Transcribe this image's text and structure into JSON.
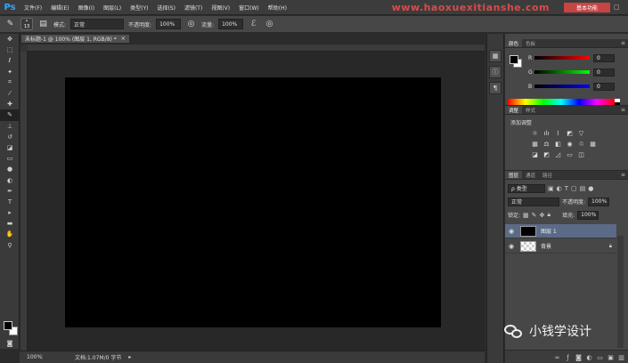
{
  "app": {
    "logo": "Ps",
    "menus": [
      "文件(F)",
      "编辑(E)",
      "图像(I)",
      "图层(L)",
      "类型(Y)",
      "选择(S)",
      "滤镜(T)",
      "视图(V)",
      "窗口(W)",
      "帮助(H)"
    ],
    "watermark": "www.haoxuexitianshe.com",
    "workspace_label": "基本功能",
    "window_controls": "▢"
  },
  "options": {
    "brush_size": "13",
    "mode_label": "模式:",
    "mode_value": "正常",
    "opacity_label": "不透明度:",
    "opacity_value": "100%",
    "flow_label": "流量:",
    "flow_value": "100%"
  },
  "document": {
    "tab_label": "未标题-1 @ 100% (图层 1, RGB/8) *",
    "zoom": "100%",
    "doc_info": "文档:1.07M/0 字节"
  },
  "color_panel": {
    "tabs": [
      "颜色",
      "色板"
    ],
    "sliders": [
      {
        "label": "R",
        "value": "0",
        "gradient": "linear-gradient(to right,#000,#ff0000)"
      },
      {
        "label": "G",
        "value": "0",
        "gradient": "linear-gradient(to right,#000,#00ff00)"
      },
      {
        "label": "B",
        "value": "0",
        "gradient": "linear-gradient(to right,#000,#0000ff)"
      }
    ]
  },
  "adjustments_panel": {
    "tabs": [
      "调整",
      "样式"
    ],
    "title": "添加调整"
  },
  "layers_panel": {
    "tabs": [
      "图层",
      "通道",
      "路径"
    ],
    "filter_label": "ρ 类型",
    "blend_mode": "正常",
    "opacity_label": "不透明度:",
    "opacity_value": "100%",
    "lock_label": "锁定:",
    "fill_label": "填充:",
    "fill_value": "100%",
    "layers": [
      {
        "name": "图层 1",
        "thumb": "black",
        "selected": true
      },
      {
        "name": "背景",
        "thumb": "checker",
        "selected": false
      }
    ]
  },
  "overlay": {
    "author": "小钱学设计"
  }
}
